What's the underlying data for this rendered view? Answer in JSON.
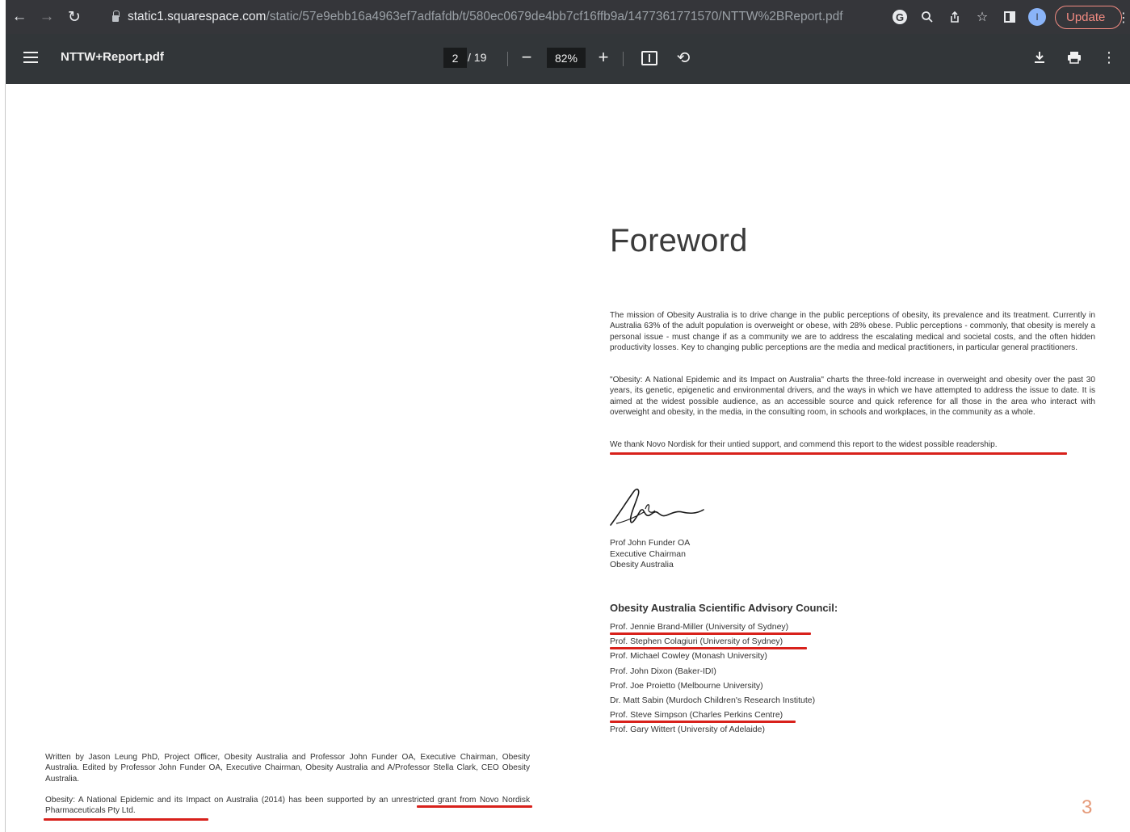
{
  "browser": {
    "url_host": "static1.squarespace.com",
    "url_path": "/static/57e9ebb16a4963ef7adfafdb/t/580ec0679de4bb7cf16ffb9a/1477361771570/NTTW%2BReport.pdf",
    "update_label": "Update",
    "avatar_initial": "I",
    "google_icon_letter": "G"
  },
  "pdf_toolbar": {
    "title": "NTTW+Report.pdf",
    "current_page": "2",
    "total_pages": "/ 19",
    "zoom": "82%"
  },
  "page": {
    "heading": "Foreword",
    "paragraphs": [
      "The mission of Obesity Australia is to drive change in the public perceptions of obesity, its prevalence and its treatment. Currently in Australia 63% of the adult population is overweight or obese, with 28% obese. Public perceptions - commonly, that obesity is merely a personal issue - must change if as a community we are to address the escalating medical and societal costs, and the often hidden productivity losses. Key to changing public perceptions are the media and medical practitioners, in particular general practitioners.",
      "\"Obesity: A National Epidemic and its Impact on Australia\" charts the three-fold increase in overweight and obesity over the past 30 years, its genetic, epigenetic and environmental drivers, and the ways in which we have attempted to address the issue to date. It is aimed at the widest possible audience, as an accessible source and quick reference for all those in the area who interact with overweight and obesity, in the media, in the consulting room, in schools and workplaces, in the community as a whole.",
      "We thank Novo Nordisk for their untied support, and commend this report to the widest possible readership."
    ],
    "signatory": {
      "name": "Prof John Funder OA",
      "role": "Executive Chairman",
      "org": "Obesity Australia"
    },
    "council_heading": "Obesity Australia Scientific Advisory Council:",
    "council_members": [
      "Prof. Jennie Brand-Miller (University of Sydney)",
      "Prof. Stephen Colagiuri (University of Sydney)",
      "Prof. Michael Cowley (Monash University)",
      "Prof. John Dixon (Baker-IDI)",
      "Prof. Joe Proietto (Melbourne University)",
      "Dr. Matt Sabin (Murdoch Children's Research Institute)",
      "Prof. Steve Simpson (Charles Perkins Centre)",
      "Prof. Gary Wittert (University of Adelaide)"
    ],
    "credits": [
      "Written by Jason Leung PhD, Project Officer, Obesity Australia and Professor John Funder OA, Executive Chairman, Obesity Australia. Edited by Professor John Funder OA, Executive Chairman, Obesity Australia and A/Professor Stella Clark, CEO Obesity Australia.",
      "Obesity: A National Epidemic and its Impact on Australia (2014) has been supported by an unrestricted grant from Novo Nordisk Pharmaceuticals Pty Ltd."
    ],
    "page_number": "3"
  },
  "colors": {
    "chrome_bg": "#35363a",
    "toolbar_bg": "#323639",
    "annotation_red": "#d8211b",
    "update_accent": "#f28b82",
    "page_number": "#e59a79"
  },
  "icons": [
    "back-arrow-icon",
    "forward-arrow-icon",
    "reload-icon",
    "lock-icon",
    "google-lens-icon",
    "zoom-magnifier-icon",
    "share-icon",
    "bookmark-star-icon",
    "side-panel-icon",
    "profile-avatar",
    "menu-icon",
    "zoom-out-icon",
    "zoom-in-icon",
    "fit-page-icon",
    "rotate-icon",
    "download-icon",
    "print-icon",
    "more-options-icon"
  ]
}
